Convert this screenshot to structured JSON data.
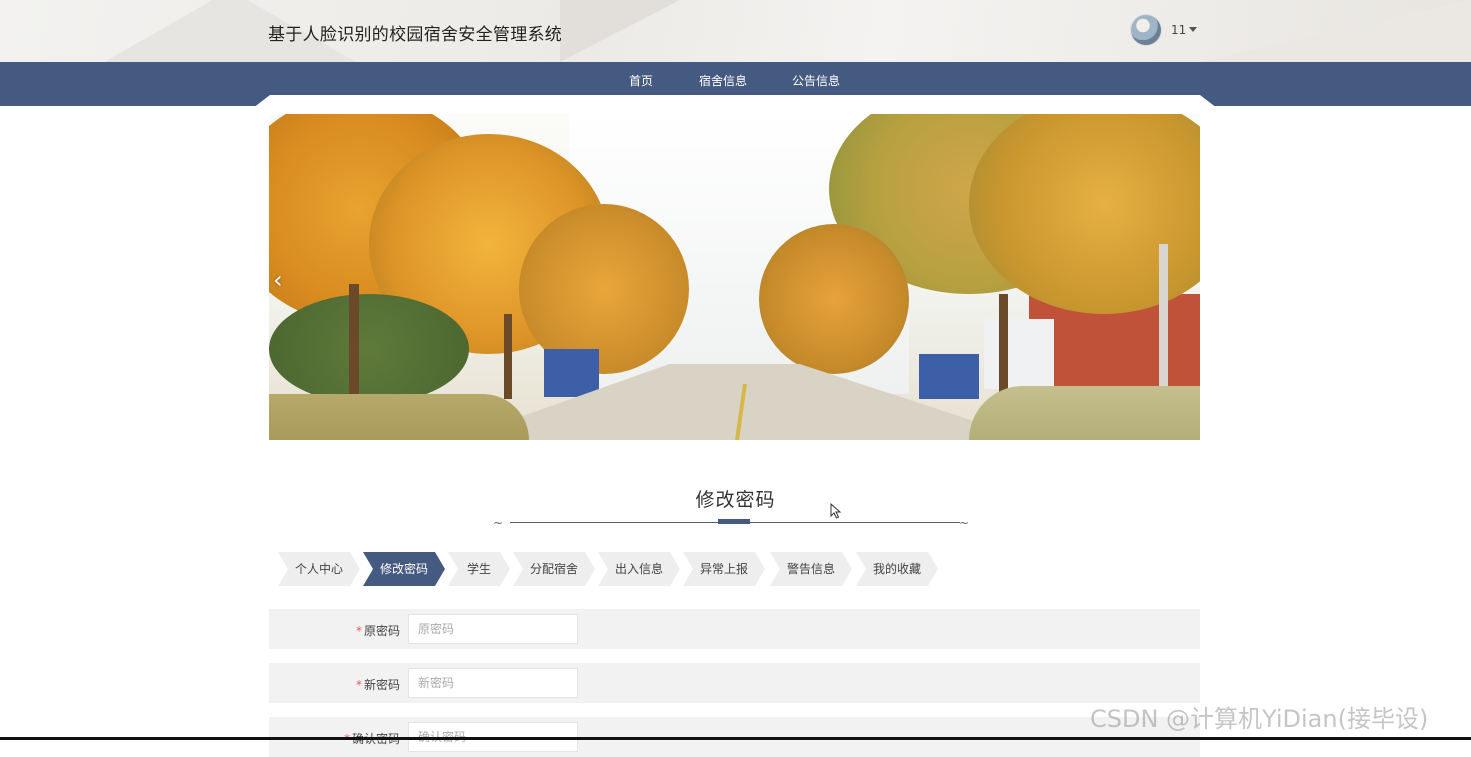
{
  "header": {
    "site_title": "基于人脸识别的校园宿舍安全管理系统",
    "username": "11"
  },
  "nav": {
    "items": [
      {
        "label": "首页"
      },
      {
        "label": "宿舍信息"
      },
      {
        "label": "公告信息"
      }
    ]
  },
  "banner": {
    "prev_arrow": "‹"
  },
  "section": {
    "title": "修改密码"
  },
  "tabs": [
    {
      "label": "个人中心",
      "active": false
    },
    {
      "label": "修改密码",
      "active": true
    },
    {
      "label": "学生",
      "active": false
    },
    {
      "label": "分配宿舍",
      "active": false
    },
    {
      "label": "出入信息",
      "active": false
    },
    {
      "label": "异常上报",
      "active": false
    },
    {
      "label": "警告信息",
      "active": false
    },
    {
      "label": "我的收藏",
      "active": false
    }
  ],
  "form": {
    "required_mark": "*",
    "fields": [
      {
        "label": "原密码",
        "placeholder": "原密码",
        "value": ""
      },
      {
        "label": "新密码",
        "placeholder": "新密码",
        "value": ""
      },
      {
        "label": "确认密码",
        "placeholder": "确认密码",
        "value": ""
      }
    ]
  },
  "watermark": "CSDN @计算机YiDian(接毕设)",
  "colors": {
    "nav_bg": "#455a80",
    "active_tab": "#455a80",
    "required": "#e85a5a"
  }
}
